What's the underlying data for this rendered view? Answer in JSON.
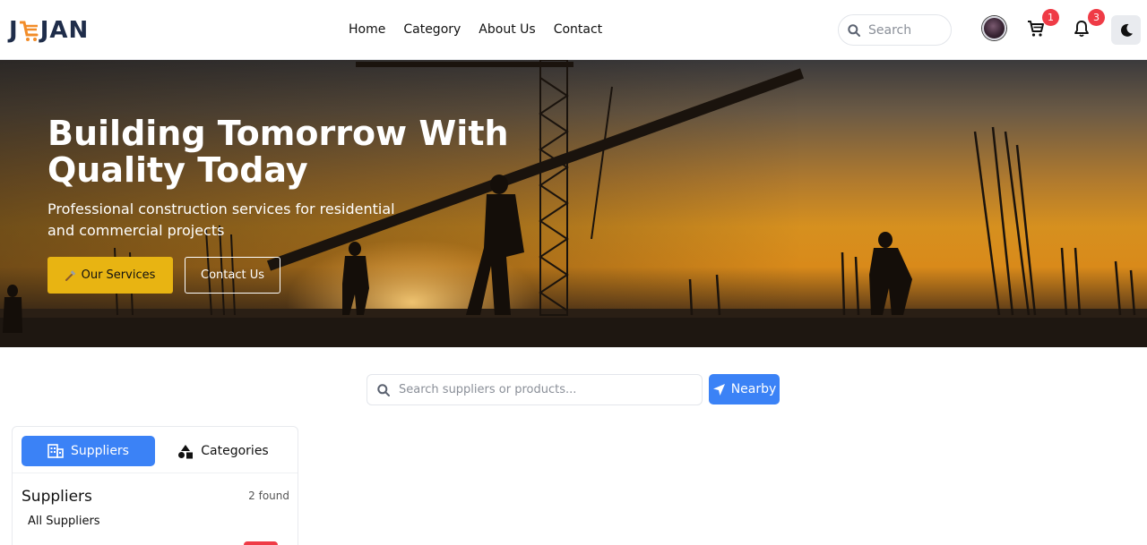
{
  "brand": {
    "logo_text": "JEJAN"
  },
  "nav": {
    "items": [
      "Home",
      "Category",
      "About Us",
      "Contact"
    ]
  },
  "header": {
    "search_placeholder": "Search",
    "cart_count": "1",
    "notification_count": "3"
  },
  "hero": {
    "title_line1": "Building Tomorrow With",
    "title_line2": "Quality Today",
    "subtitle": "Professional construction services for residential and commercial projects",
    "primary_button": "Our Services",
    "secondary_button": "Contact Us"
  },
  "search": {
    "placeholder": "Search suppliers or products...",
    "nearby_label": "Nearby"
  },
  "panel": {
    "tabs": [
      "Suppliers",
      "Categories"
    ],
    "active_tab": "Suppliers",
    "title": "Suppliers",
    "count": "2 found",
    "filter_label": "All Suppliers"
  },
  "colors": {
    "accent_blue": "#3b82f6",
    "accent_yellow": "#e8b412",
    "badge_red": "#ef3b46",
    "brand_navy": "#1f2d4a",
    "brand_orange": "#f28c28"
  }
}
